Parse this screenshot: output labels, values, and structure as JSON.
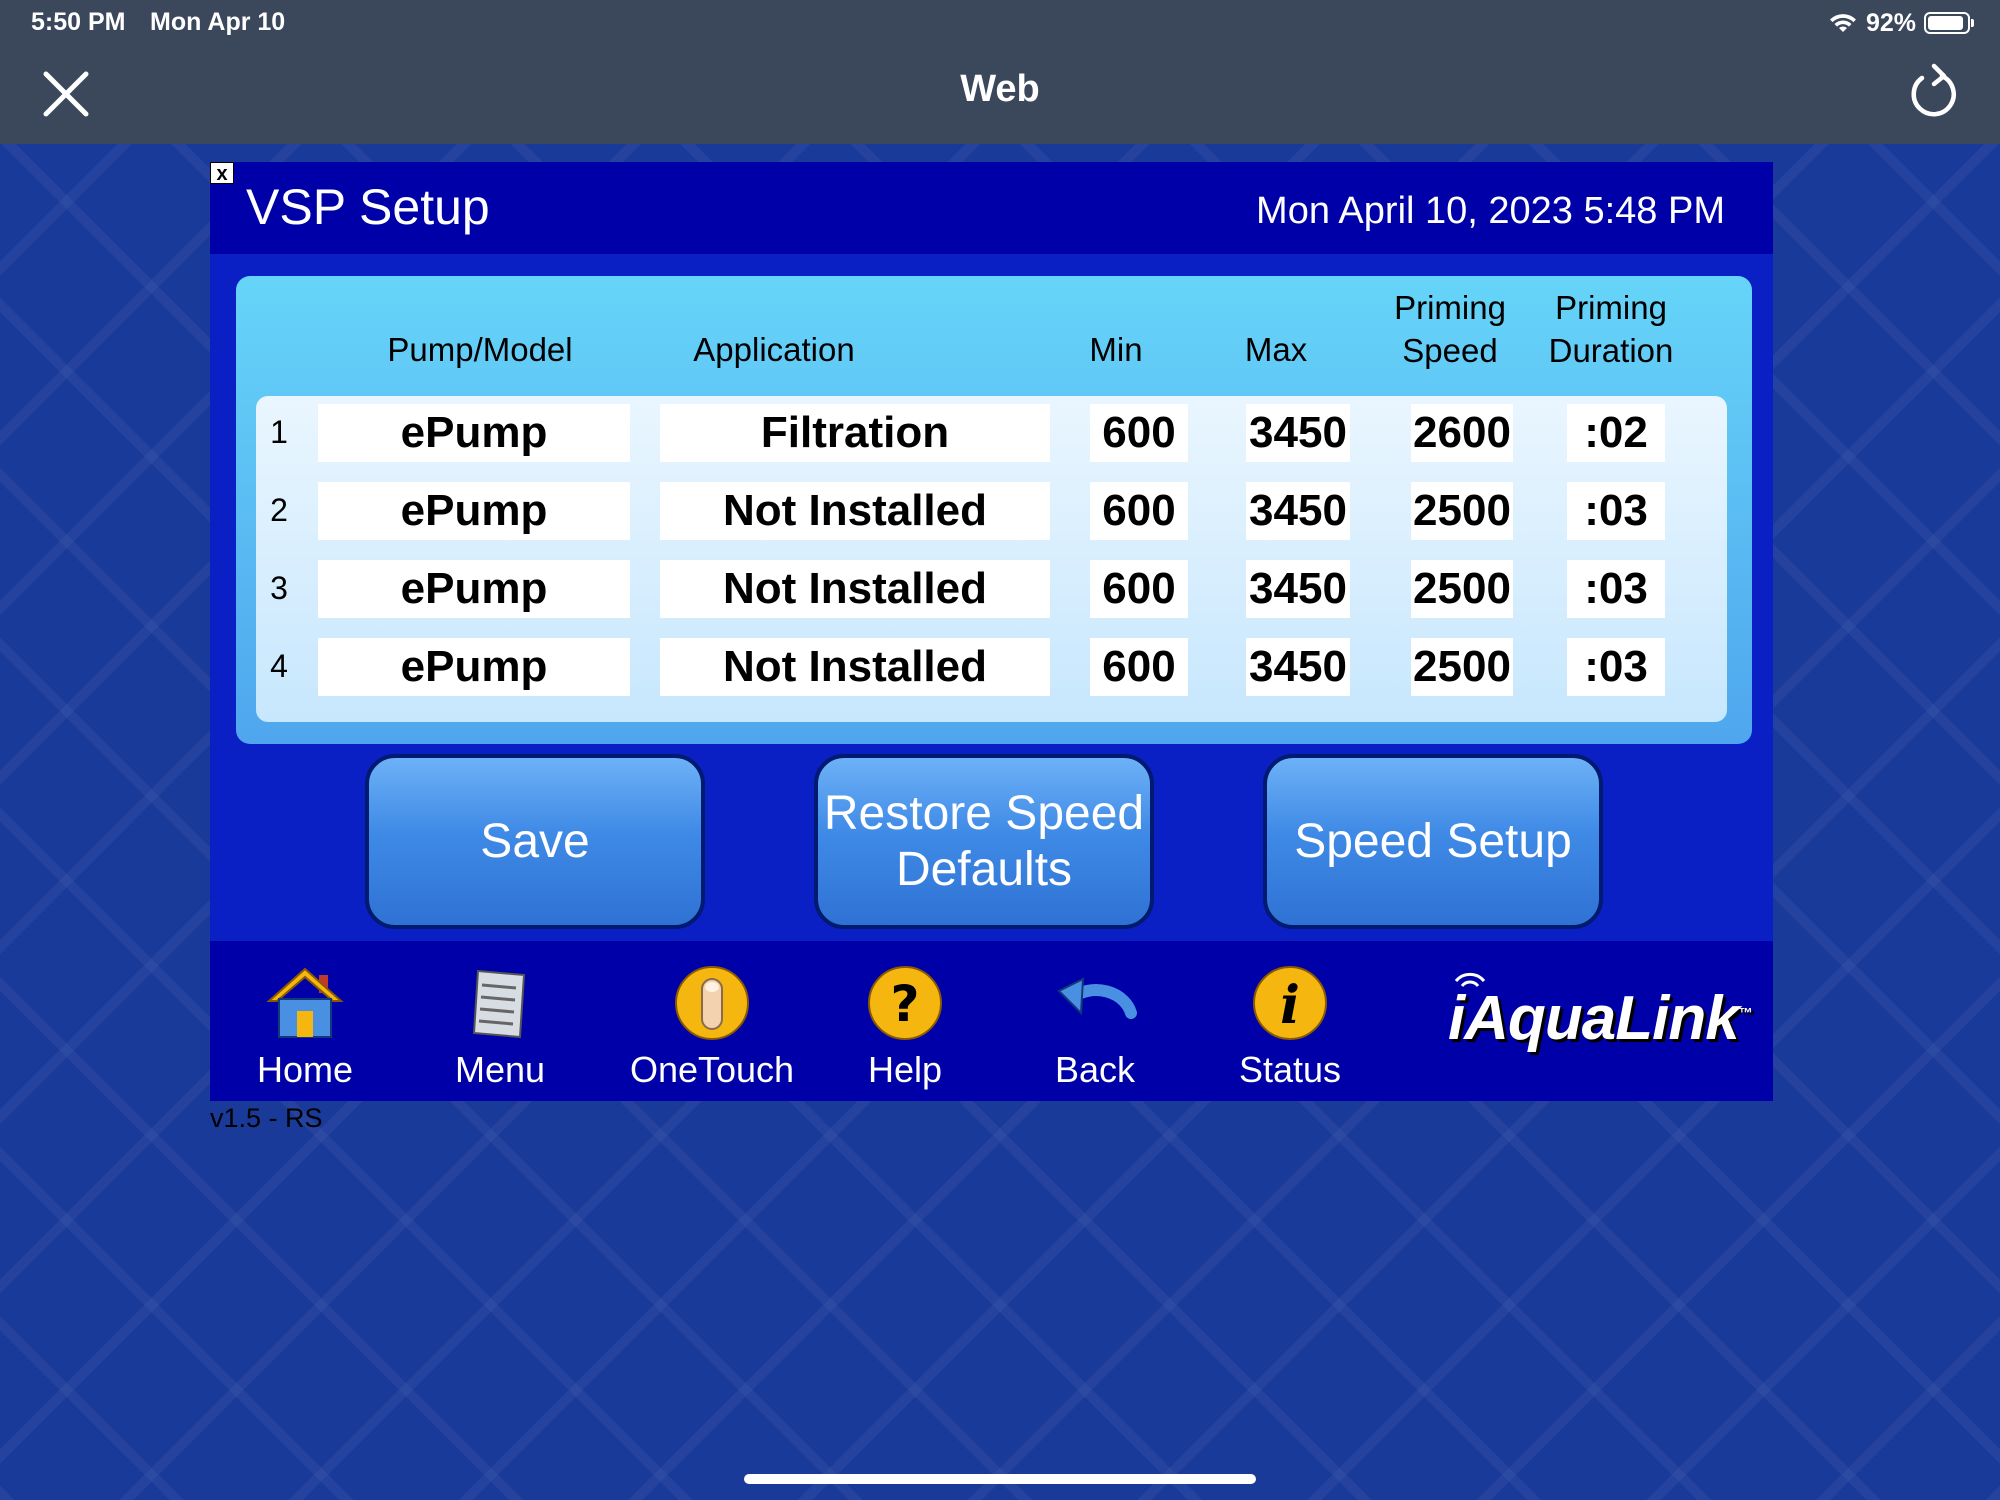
{
  "status_bar": {
    "time": "5:50 PM",
    "date": "Mon Apr 10",
    "battery": "92%"
  },
  "nav_bar": {
    "title": "Web"
  },
  "panel": {
    "close_label": "x",
    "title": "VSP Setup",
    "datetime": "Mon April 10, 2023 5:48 PM",
    "columns": {
      "pump": "Pump/Model",
      "application": "Application",
      "min": "Min",
      "max": "Max",
      "priming_speed_1": "Priming",
      "priming_speed_2": "Speed",
      "priming_duration_1": "Priming",
      "priming_duration_2": "Duration"
    },
    "rows": [
      {
        "num": "1",
        "pump": "ePump",
        "application": "Filtration",
        "min": "600",
        "max": "3450",
        "priming_speed": "2600",
        "priming_duration": ":02"
      },
      {
        "num": "2",
        "pump": "ePump",
        "application": "Not Installed",
        "min": "600",
        "max": "3450",
        "priming_speed": "2500",
        "priming_duration": ":03"
      },
      {
        "num": "3",
        "pump": "ePump",
        "application": "Not Installed",
        "min": "600",
        "max": "3450",
        "priming_speed": "2500",
        "priming_duration": ":03"
      },
      {
        "num": "4",
        "pump": "ePump",
        "application": "Not Installed",
        "min": "600",
        "max": "3450",
        "priming_speed": "2500",
        "priming_duration": ":03"
      }
    ],
    "buttons": {
      "save": "Save",
      "restore_1": "Restore Speed",
      "restore_2": "Defaults",
      "speed_setup": "Speed Setup"
    }
  },
  "footer": {
    "items": [
      {
        "label": "Home",
        "icon": "home-icon"
      },
      {
        "label": "Menu",
        "icon": "menu-icon"
      },
      {
        "label": "OneTouch",
        "icon": "onetouch-icon"
      },
      {
        "label": "Help",
        "icon": "help-icon"
      },
      {
        "label": "Back",
        "icon": "back-icon"
      },
      {
        "label": "Status",
        "icon": "status-icon"
      }
    ],
    "logo": "iAquaLink",
    "logo_tm": "™"
  },
  "version": "v1.5 - RS",
  "colors": {
    "topbar": "#3b475b",
    "panel_header": "#0000a8",
    "panel_body": "#0a1fc4",
    "table_card": "#66d4f8",
    "button": "#3f8ae6",
    "icon_yellow": "#f5b70f"
  }
}
